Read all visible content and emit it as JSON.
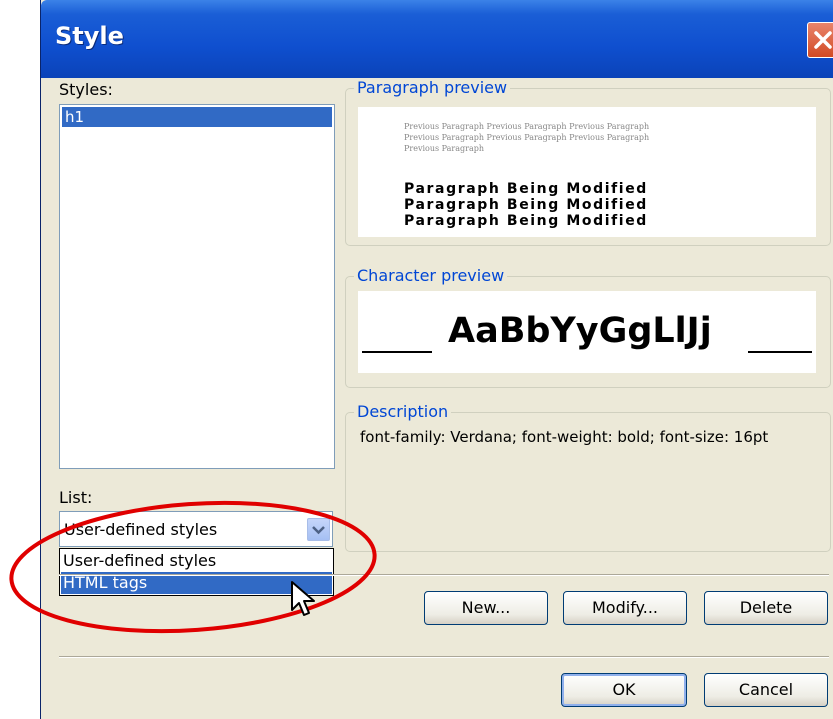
{
  "window": {
    "title": "Style",
    "close_icon": "close-icon"
  },
  "styles": {
    "label": "Styles:",
    "items": [
      "h1"
    ],
    "selected": "h1"
  },
  "list": {
    "label": "List:",
    "current_value": "User-defined styles",
    "options": [
      "User-defined styles",
      "HTML tags"
    ],
    "highlighted": "HTML tags"
  },
  "paragraph_preview": {
    "label": "Paragraph preview",
    "previous_lines": [
      "Previous Paragraph Previous Paragraph Previous Paragraph",
      "Previous Paragraph Previous Paragraph Previous Paragraph",
      "Previous Paragraph"
    ],
    "modified_lines": [
      "Paragraph Being Modified",
      "Paragraph Being Modified",
      "Paragraph Being Modified"
    ]
  },
  "character_preview": {
    "label": "Character preview",
    "sample": "AaBbYyGgLlJj"
  },
  "description": {
    "label": "Description",
    "text": "font-family: Verdana; font-weight: bold; font-size: 16pt"
  },
  "buttons": {
    "new": "New...",
    "modify": "Modify...",
    "delete": "Delete",
    "ok": "OK",
    "cancel": "Cancel"
  },
  "colors": {
    "title_bar": "#0f4fcf",
    "selection": "#316ac5",
    "group_label": "#0046d5",
    "annotation": "#e00000"
  }
}
